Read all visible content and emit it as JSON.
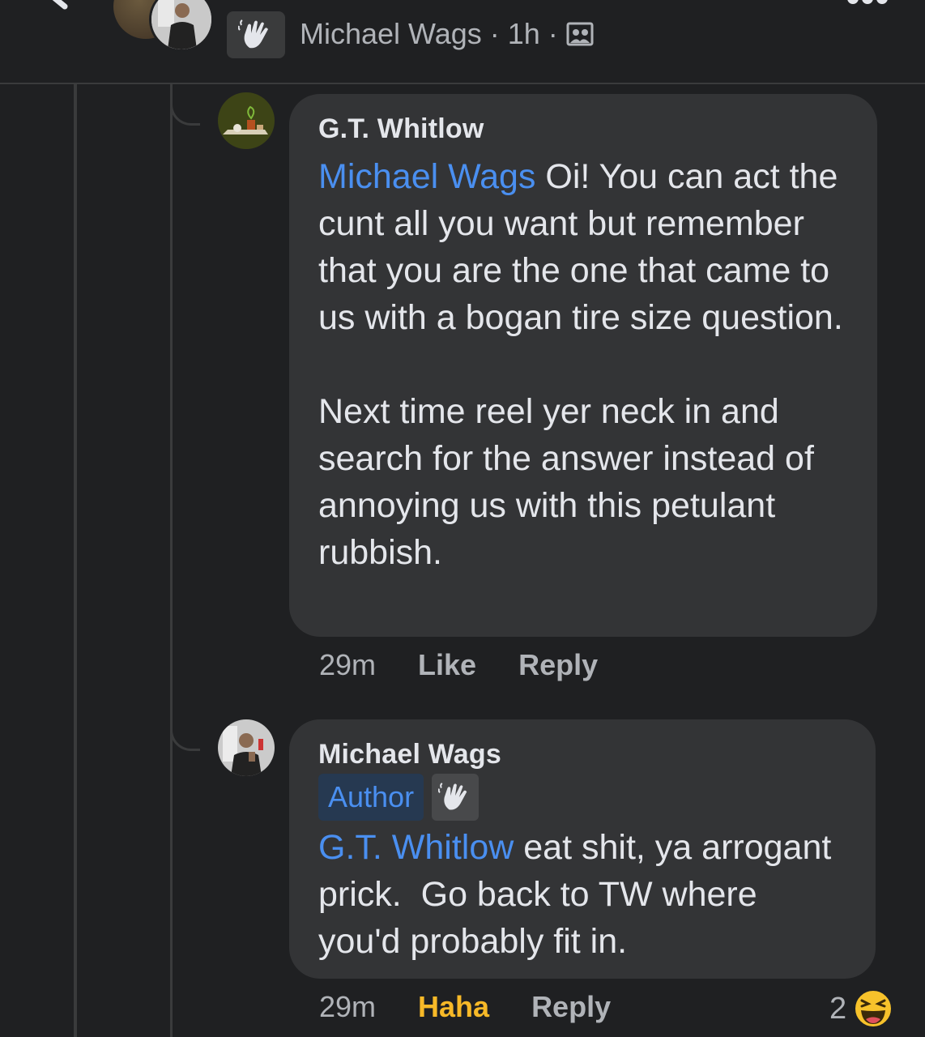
{
  "header": {
    "author": "Michael Wags",
    "separator": "·",
    "time": "1h",
    "separator2": "·",
    "icons": {
      "back": "chevron-left-icon",
      "wave": "waving-hand-icon",
      "audience": "group-icon",
      "more": "more-dots-icon"
    }
  },
  "comments": [
    {
      "author": "G.T. Whitlow",
      "mention": "Michael Wags",
      "text": " Oi! You can act the cunt all you want but remember that you are the one that came to us with a bogan tire size question.\n\nNext time reel yer neck in and search for the answer instead of annoying us with this petulant rubbish.",
      "time": "29m",
      "like_label": "Like",
      "reply_label": "Reply"
    },
    {
      "author": "Michael Wags",
      "badge": "Author",
      "mention": "G.T. Whitlow",
      "text": " eat shit, ya arrogant prick.  Go back to TW where you'd probably fit in.",
      "time": "29m",
      "reaction_label": "Haha",
      "reply_label": "Reply",
      "reaction_count": "2",
      "reaction_icon": "laughing-emoji-icon"
    }
  ],
  "colors": {
    "background": "#1f2022",
    "bubble": "#333436",
    "mention": "#4a8ff0",
    "haha": "#f7b928",
    "muted": "#b0b3b8"
  }
}
